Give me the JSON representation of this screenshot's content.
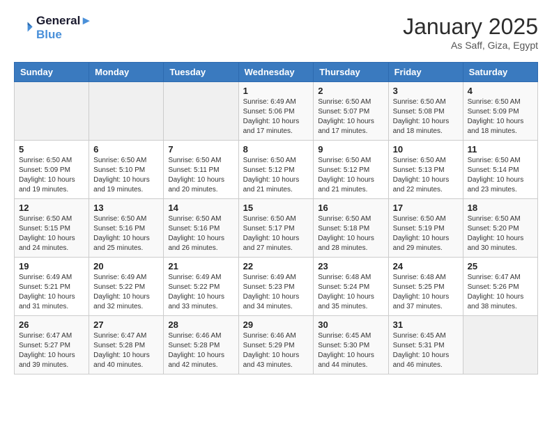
{
  "logo": {
    "line1": "General",
    "line2": "Blue"
  },
  "title": "January 2025",
  "location": "As Saff, Giza, Egypt",
  "weekdays": [
    "Sunday",
    "Monday",
    "Tuesday",
    "Wednesday",
    "Thursday",
    "Friday",
    "Saturday"
  ],
  "weeks": [
    [
      {
        "day": "",
        "info": ""
      },
      {
        "day": "",
        "info": ""
      },
      {
        "day": "",
        "info": ""
      },
      {
        "day": "1",
        "info": "Sunrise: 6:49 AM\nSunset: 5:06 PM\nDaylight: 10 hours\nand 17 minutes."
      },
      {
        "day": "2",
        "info": "Sunrise: 6:50 AM\nSunset: 5:07 PM\nDaylight: 10 hours\nand 17 minutes."
      },
      {
        "day": "3",
        "info": "Sunrise: 6:50 AM\nSunset: 5:08 PM\nDaylight: 10 hours\nand 18 minutes."
      },
      {
        "day": "4",
        "info": "Sunrise: 6:50 AM\nSunset: 5:09 PM\nDaylight: 10 hours\nand 18 minutes."
      }
    ],
    [
      {
        "day": "5",
        "info": "Sunrise: 6:50 AM\nSunset: 5:09 PM\nDaylight: 10 hours\nand 19 minutes."
      },
      {
        "day": "6",
        "info": "Sunrise: 6:50 AM\nSunset: 5:10 PM\nDaylight: 10 hours\nand 19 minutes."
      },
      {
        "day": "7",
        "info": "Sunrise: 6:50 AM\nSunset: 5:11 PM\nDaylight: 10 hours\nand 20 minutes."
      },
      {
        "day": "8",
        "info": "Sunrise: 6:50 AM\nSunset: 5:12 PM\nDaylight: 10 hours\nand 21 minutes."
      },
      {
        "day": "9",
        "info": "Sunrise: 6:50 AM\nSunset: 5:12 PM\nDaylight: 10 hours\nand 21 minutes."
      },
      {
        "day": "10",
        "info": "Sunrise: 6:50 AM\nSunset: 5:13 PM\nDaylight: 10 hours\nand 22 minutes."
      },
      {
        "day": "11",
        "info": "Sunrise: 6:50 AM\nSunset: 5:14 PM\nDaylight: 10 hours\nand 23 minutes."
      }
    ],
    [
      {
        "day": "12",
        "info": "Sunrise: 6:50 AM\nSunset: 5:15 PM\nDaylight: 10 hours\nand 24 minutes."
      },
      {
        "day": "13",
        "info": "Sunrise: 6:50 AM\nSunset: 5:16 PM\nDaylight: 10 hours\nand 25 minutes."
      },
      {
        "day": "14",
        "info": "Sunrise: 6:50 AM\nSunset: 5:16 PM\nDaylight: 10 hours\nand 26 minutes."
      },
      {
        "day": "15",
        "info": "Sunrise: 6:50 AM\nSunset: 5:17 PM\nDaylight: 10 hours\nand 27 minutes."
      },
      {
        "day": "16",
        "info": "Sunrise: 6:50 AM\nSunset: 5:18 PM\nDaylight: 10 hours\nand 28 minutes."
      },
      {
        "day": "17",
        "info": "Sunrise: 6:50 AM\nSunset: 5:19 PM\nDaylight: 10 hours\nand 29 minutes."
      },
      {
        "day": "18",
        "info": "Sunrise: 6:50 AM\nSunset: 5:20 PM\nDaylight: 10 hours\nand 30 minutes."
      }
    ],
    [
      {
        "day": "19",
        "info": "Sunrise: 6:49 AM\nSunset: 5:21 PM\nDaylight: 10 hours\nand 31 minutes."
      },
      {
        "day": "20",
        "info": "Sunrise: 6:49 AM\nSunset: 5:22 PM\nDaylight: 10 hours\nand 32 minutes."
      },
      {
        "day": "21",
        "info": "Sunrise: 6:49 AM\nSunset: 5:22 PM\nDaylight: 10 hours\nand 33 minutes."
      },
      {
        "day": "22",
        "info": "Sunrise: 6:49 AM\nSunset: 5:23 PM\nDaylight: 10 hours\nand 34 minutes."
      },
      {
        "day": "23",
        "info": "Sunrise: 6:48 AM\nSunset: 5:24 PM\nDaylight: 10 hours\nand 35 minutes."
      },
      {
        "day": "24",
        "info": "Sunrise: 6:48 AM\nSunset: 5:25 PM\nDaylight: 10 hours\nand 37 minutes."
      },
      {
        "day": "25",
        "info": "Sunrise: 6:47 AM\nSunset: 5:26 PM\nDaylight: 10 hours\nand 38 minutes."
      }
    ],
    [
      {
        "day": "26",
        "info": "Sunrise: 6:47 AM\nSunset: 5:27 PM\nDaylight: 10 hours\nand 39 minutes."
      },
      {
        "day": "27",
        "info": "Sunrise: 6:47 AM\nSunset: 5:28 PM\nDaylight: 10 hours\nand 40 minutes."
      },
      {
        "day": "28",
        "info": "Sunrise: 6:46 AM\nSunset: 5:28 PM\nDaylight: 10 hours\nand 42 minutes."
      },
      {
        "day": "29",
        "info": "Sunrise: 6:46 AM\nSunset: 5:29 PM\nDaylight: 10 hours\nand 43 minutes."
      },
      {
        "day": "30",
        "info": "Sunrise: 6:45 AM\nSunset: 5:30 PM\nDaylight: 10 hours\nand 44 minutes."
      },
      {
        "day": "31",
        "info": "Sunrise: 6:45 AM\nSunset: 5:31 PM\nDaylight: 10 hours\nand 46 minutes."
      },
      {
        "day": "",
        "info": ""
      }
    ]
  ]
}
